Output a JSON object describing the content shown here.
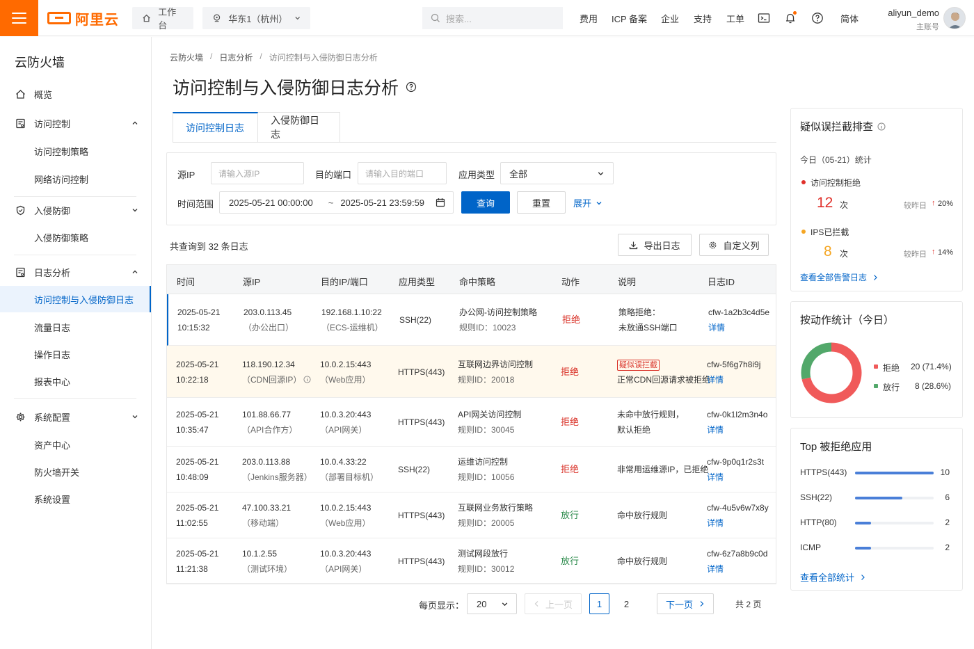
{
  "topbar": {
    "logo_text": "阿里云",
    "workbench": "工作台",
    "region": "华东1（杭州）",
    "search_placeholder": "搜索...",
    "nav": [
      "费用",
      "ICP 备案",
      "企业",
      "支持",
      "工单"
    ],
    "lang": "简体",
    "user_name": "aliyun_demo",
    "user_role": "主账号",
    "accent": "#ff6a00"
  },
  "sidebar": {
    "title": "云防火墙",
    "items": [
      {
        "label": "概览"
      },
      {
        "label": "访问控制"
      },
      {
        "label": "访问控制策略"
      },
      {
        "label": "网络访问控制"
      },
      {
        "label": "入侵防御"
      },
      {
        "label": "入侵防御策略"
      },
      {
        "label": "日志分析"
      },
      {
        "label": "访问控制与入侵防御日志"
      },
      {
        "label": "流量日志"
      },
      {
        "label": "操作日志"
      },
      {
        "label": "报表中心"
      },
      {
        "label": "系统配置"
      },
      {
        "label": "资产中心"
      },
      {
        "label": "防火墙开关"
      },
      {
        "label": "系统设置"
      }
    ]
  },
  "breadcrumb": [
    "云防火墙",
    "日志分析",
    "访问控制与入侵防御日志分析"
  ],
  "page_title": "访问控制与入侵防御日志分析",
  "tabs": [
    "访问控制日志",
    "入侵防御日志"
  ],
  "filter": {
    "src_ip_label": "源IP",
    "src_ip_placeholder": "请输入源IP",
    "dst_port_label": "目的端口",
    "dst_port_placeholder": "请输入目的端口",
    "app_type_label": "应用类型",
    "app_type_value": "全部",
    "time_label": "时间范围",
    "time_start": "2025-05-21 00:00:00",
    "time_sep": "~",
    "time_end": "2025-05-21 23:59:59",
    "query_btn": "查询",
    "reset_btn": "重置",
    "expand": "展开"
  },
  "summary": "共查询到 32 条日志",
  "export_btn": "导出日志",
  "custom_col_btn": "自定义列",
  "table": {
    "headers": [
      "时间",
      "源IP",
      "目的IP/端口",
      "应用类型",
      "命中策略",
      "动作",
      "说明",
      "日志ID"
    ],
    "rows": [
      {
        "date": "2025-05-21",
        "time": "10:15:32",
        "src": "203.0.113.45",
        "src_note": "（办公出口）",
        "dst": "192.168.1.10:22",
        "dst_note": "（ECS-运维机）",
        "app": "SSH(22)",
        "policy": "办公网-访问控制策略",
        "rule": "规则ID：10023",
        "action": "拒绝",
        "desc1": "策略拒绝：",
        "desc2": "未放通SSH端口",
        "tag": "",
        "log_id": "cfw-1a2b3c4d5e",
        "detail": "详情"
      },
      {
        "date": "2025-05-21",
        "time": "10:22:18",
        "src": "118.190.12.34",
        "src_note": "（CDN回源IP）",
        "dst": "10.0.2.15:443",
        "dst_note": "（Web应用）",
        "app": "HTTPS(443)",
        "policy": "互联网边界访问控制",
        "rule": "规则ID：20018",
        "action": "拒绝",
        "desc1": "",
        "desc2": "正常CDN回源请求被拒绝",
        "tag": "疑似误拦截",
        "log_id": "cfw-5f6g7h8i9j",
        "detail": "详情"
      },
      {
        "date": "2025-05-21",
        "time": "10:35:47",
        "src": "101.88.66.77",
        "src_note": "（API合作方）",
        "dst": "10.0.3.20:443",
        "dst_note": "（API网关）",
        "app": "HTTPS(443)",
        "policy": "API网关访问控制",
        "rule": "规则ID：30045",
        "action": "拒绝",
        "desc1": "未命中放行规则，",
        "desc2": "默认拒绝",
        "tag": "",
        "log_id": "cfw-0k1l2m3n4o",
        "detail": "详情"
      },
      {
        "date": "2025-05-21",
        "time": "10:48:09",
        "src": "203.0.113.88",
        "src_note": "（Jenkins服务器）",
        "dst": "10.0.4.33:22",
        "dst_note": "（部署目标机）",
        "app": "SSH(22)",
        "policy": "运维访问控制",
        "rule": "规则ID：10056",
        "action": "拒绝",
        "desc1": "非常用运维源IP，已拒绝",
        "desc2": "",
        "tag": "",
        "log_id": "cfw-9p0q1r2s3t",
        "detail": "详情"
      },
      {
        "date": "2025-05-21",
        "time": "11:02:55",
        "src": "47.100.33.21",
        "src_note": "（移动端）",
        "dst": "10.0.2.15:443",
        "dst_note": "（Web应用）",
        "app": "HTTPS(443)",
        "policy": "互联网业务放行策略",
        "rule": "规则ID：20005",
        "action": "放行",
        "desc1": "命中放行规则",
        "desc2": "",
        "tag": "",
        "log_id": "cfw-4u5v6w7x8y",
        "detail": "详情"
      },
      {
        "date": "2025-05-21",
        "time": "11:21:38",
        "src": "10.1.2.55",
        "src_note": "（测试环境）",
        "dst": "10.0.3.20:443",
        "dst_note": "（API网关）",
        "app": "HTTPS(443)",
        "policy": "测试网段放行",
        "rule": "规则ID：30012",
        "action": "放行",
        "desc1": "命中放行规则",
        "desc2": "",
        "tag": "",
        "log_id": "cfw-6z7a8b9c0d",
        "detail": "详情"
      }
    ]
  },
  "pagination": {
    "page_size_label": "每页显示：",
    "page_size": "20",
    "prev": "上一页",
    "pages": [
      "1",
      "2"
    ],
    "current": "1",
    "next": "下一页",
    "total_pages": "共 2 页"
  },
  "panel_misblock": {
    "title": "疑似误拦截排查",
    "subtitle": "今日（05-21）统计",
    "acl_label": "访问控制拒绝",
    "acl_count": "12",
    "acl_unit": "次",
    "acl_compare": "较昨日",
    "acl_change": "20%",
    "ips_label": "IPS已拦截",
    "ips_count": "8",
    "ips_unit": "次",
    "ips_compare": "较昨日",
    "ips_change": "14%",
    "link": "查看全部告警日志"
  },
  "panel_action": {
    "title": "按动作统计（今日）",
    "deny_label": "拒绝",
    "deny_value": "20 (71.4%)",
    "deny_fraction": 0.714,
    "allow_label": "放行",
    "allow_value": "8 (28.6%)",
    "deny_color": "#f05a5a",
    "allow_color": "#52a86a"
  },
  "panel_top": {
    "title": "Top 被拒绝应用",
    "items": [
      {
        "name": "HTTPS(443)",
        "count": "10",
        "value": 10
      },
      {
        "name": "SSH(22)",
        "count": "6",
        "value": 6
      },
      {
        "name": "HTTP(80)",
        "count": "2",
        "value": 2
      },
      {
        "name": "ICMP",
        "count": "2",
        "value": 2
      }
    ],
    "max": 10,
    "link": "查看全部统计"
  }
}
